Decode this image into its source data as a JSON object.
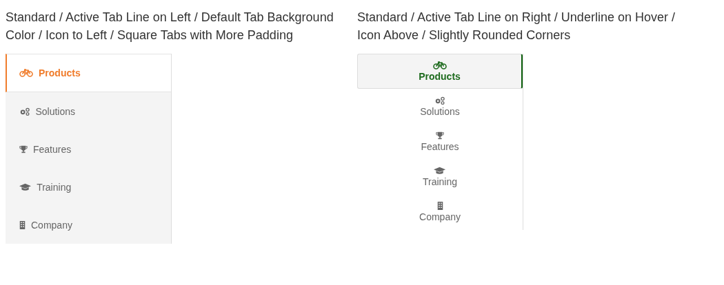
{
  "panels": [
    {
      "kind": "left-line",
      "title": "Standard / Active Tab Line on Left / Default Tab Background Color / Icon to Left / Square Tabs with More Padding",
      "tabs": [
        {
          "label": "Products",
          "selected": true
        },
        {
          "label": "Solutions",
          "selected": false
        },
        {
          "label": "Features",
          "selected": false
        },
        {
          "label": "Training",
          "selected": false
        },
        {
          "label": "Company",
          "selected": false
        }
      ]
    },
    {
      "kind": "right-line",
      "title": "Standard / Active Tab Line on Right / Underline on Hover / Icon Above / Slightly Rounded Corners",
      "tabs": [
        {
          "label": "Products",
          "selected": true
        },
        {
          "label": "Solutions",
          "selected": false
        },
        {
          "label": "Features",
          "selected": false
        },
        {
          "label": "Training",
          "selected": false
        },
        {
          "label": "Company",
          "selected": false
        }
      ]
    }
  ]
}
